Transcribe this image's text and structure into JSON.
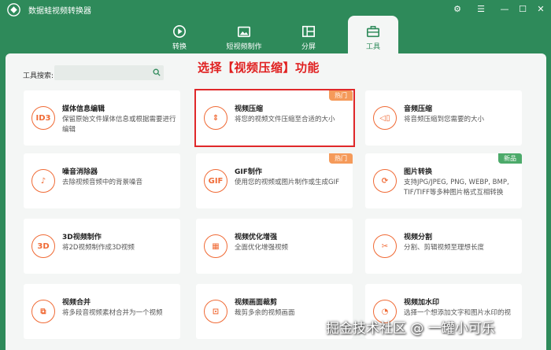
{
  "app": {
    "title": "数据蛙视频转换器",
    "brand_color": "#2e8a5a",
    "accent": "#f06a35"
  },
  "window_controls": [
    "⚙",
    "☰",
    "—",
    "☐",
    "✕"
  ],
  "nav": [
    {
      "label": "转换",
      "icon": "convert-icon"
    },
    {
      "label": "短视频制作",
      "icon": "short-video-icon"
    },
    {
      "label": "分屏",
      "icon": "split-screen-icon"
    },
    {
      "label": "工具",
      "icon": "toolbox-icon",
      "active": true
    }
  ],
  "search": {
    "label": "工具搜索:",
    "value": ""
  },
  "annotation": "选择【视频压缩】功能",
  "cards": [
    {
      "title": "媒体信息编辑",
      "desc": "保留原始文件媒体信息或根据需要进行编辑",
      "icon": "id3-icon",
      "glyph": "ID3"
    },
    {
      "title": "视频压缩",
      "desc": "将您的视频文件压缩至合适的大小",
      "icon": "compress-icon",
      "glyph": "⇕",
      "badge": "热门"
    },
    {
      "title": "音频压缩",
      "desc": "将音频压缩到您需要的大小",
      "icon": "audio-compress-icon",
      "glyph": "◁▯"
    },
    {
      "title": "噪音消除器",
      "desc": "去除视频音频中的背景噪音",
      "icon": "noise-icon",
      "glyph": "♪"
    },
    {
      "title": "GIF制作",
      "desc": "使用您的视频或图片制作或生成GIF",
      "icon": "gif-icon",
      "glyph": "GIF",
      "badge": "热门"
    },
    {
      "title": "图片转换",
      "desc": "支持JPG/JPEG, PNG, WEBP, BMP, TIF/TIFF等多种图片格式互相转换",
      "icon": "image-convert-icon",
      "glyph": "⟳",
      "badge": "新品"
    },
    {
      "title": "3D视频制作",
      "desc": "将2D视频制作成3D视频",
      "icon": "3d-icon",
      "glyph": "3D"
    },
    {
      "title": "视频优化增强",
      "desc": "全面优化增强视频",
      "icon": "enhance-icon",
      "glyph": "▦"
    },
    {
      "title": "视频分割",
      "desc": "分割、剪辑视频至理想长度",
      "icon": "scissors-icon",
      "glyph": "✂"
    },
    {
      "title": "视频合并",
      "desc": "将多段音视频素材合并为一个视频",
      "icon": "merge-icon",
      "glyph": "⧉"
    },
    {
      "title": "视频画面裁剪",
      "desc": "裁剪多余的视频画面",
      "icon": "crop-icon",
      "glyph": "⊡"
    },
    {
      "title": "视频加水印",
      "desc": "选择一个想添加文字和图片水印的视",
      "icon": "watermark-icon",
      "glyph": "◔"
    }
  ],
  "watermark": "掘金技术社区 @ 一罐小可乐"
}
